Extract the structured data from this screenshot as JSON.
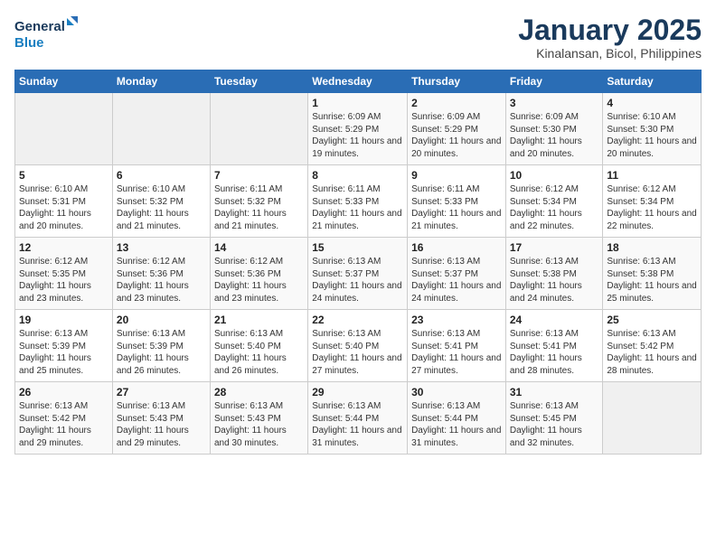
{
  "header": {
    "logo_line1": "General",
    "logo_line2": "Blue",
    "month": "January 2025",
    "location": "Kinalansan, Bicol, Philippines"
  },
  "weekdays": [
    "Sunday",
    "Monday",
    "Tuesday",
    "Wednesday",
    "Thursday",
    "Friday",
    "Saturday"
  ],
  "weeks": [
    [
      {
        "day": "",
        "info": ""
      },
      {
        "day": "",
        "info": ""
      },
      {
        "day": "",
        "info": ""
      },
      {
        "day": "1",
        "info": "Sunrise: 6:09 AM\nSunset: 5:29 PM\nDaylight: 11 hours and 19 minutes."
      },
      {
        "day": "2",
        "info": "Sunrise: 6:09 AM\nSunset: 5:29 PM\nDaylight: 11 hours and 20 minutes."
      },
      {
        "day": "3",
        "info": "Sunrise: 6:09 AM\nSunset: 5:30 PM\nDaylight: 11 hours and 20 minutes."
      },
      {
        "day": "4",
        "info": "Sunrise: 6:10 AM\nSunset: 5:30 PM\nDaylight: 11 hours and 20 minutes."
      }
    ],
    [
      {
        "day": "5",
        "info": "Sunrise: 6:10 AM\nSunset: 5:31 PM\nDaylight: 11 hours and 20 minutes."
      },
      {
        "day": "6",
        "info": "Sunrise: 6:10 AM\nSunset: 5:32 PM\nDaylight: 11 hours and 21 minutes."
      },
      {
        "day": "7",
        "info": "Sunrise: 6:11 AM\nSunset: 5:32 PM\nDaylight: 11 hours and 21 minutes."
      },
      {
        "day": "8",
        "info": "Sunrise: 6:11 AM\nSunset: 5:33 PM\nDaylight: 11 hours and 21 minutes."
      },
      {
        "day": "9",
        "info": "Sunrise: 6:11 AM\nSunset: 5:33 PM\nDaylight: 11 hours and 21 minutes."
      },
      {
        "day": "10",
        "info": "Sunrise: 6:12 AM\nSunset: 5:34 PM\nDaylight: 11 hours and 22 minutes."
      },
      {
        "day": "11",
        "info": "Sunrise: 6:12 AM\nSunset: 5:34 PM\nDaylight: 11 hours and 22 minutes."
      }
    ],
    [
      {
        "day": "12",
        "info": "Sunrise: 6:12 AM\nSunset: 5:35 PM\nDaylight: 11 hours and 23 minutes."
      },
      {
        "day": "13",
        "info": "Sunrise: 6:12 AM\nSunset: 5:36 PM\nDaylight: 11 hours and 23 minutes."
      },
      {
        "day": "14",
        "info": "Sunrise: 6:12 AM\nSunset: 5:36 PM\nDaylight: 11 hours and 23 minutes."
      },
      {
        "day": "15",
        "info": "Sunrise: 6:13 AM\nSunset: 5:37 PM\nDaylight: 11 hours and 24 minutes."
      },
      {
        "day": "16",
        "info": "Sunrise: 6:13 AM\nSunset: 5:37 PM\nDaylight: 11 hours and 24 minutes."
      },
      {
        "day": "17",
        "info": "Sunrise: 6:13 AM\nSunset: 5:38 PM\nDaylight: 11 hours and 24 minutes."
      },
      {
        "day": "18",
        "info": "Sunrise: 6:13 AM\nSunset: 5:38 PM\nDaylight: 11 hours and 25 minutes."
      }
    ],
    [
      {
        "day": "19",
        "info": "Sunrise: 6:13 AM\nSunset: 5:39 PM\nDaylight: 11 hours and 25 minutes."
      },
      {
        "day": "20",
        "info": "Sunrise: 6:13 AM\nSunset: 5:39 PM\nDaylight: 11 hours and 26 minutes."
      },
      {
        "day": "21",
        "info": "Sunrise: 6:13 AM\nSunset: 5:40 PM\nDaylight: 11 hours and 26 minutes."
      },
      {
        "day": "22",
        "info": "Sunrise: 6:13 AM\nSunset: 5:40 PM\nDaylight: 11 hours and 27 minutes."
      },
      {
        "day": "23",
        "info": "Sunrise: 6:13 AM\nSunset: 5:41 PM\nDaylight: 11 hours and 27 minutes."
      },
      {
        "day": "24",
        "info": "Sunrise: 6:13 AM\nSunset: 5:41 PM\nDaylight: 11 hours and 28 minutes."
      },
      {
        "day": "25",
        "info": "Sunrise: 6:13 AM\nSunset: 5:42 PM\nDaylight: 11 hours and 28 minutes."
      }
    ],
    [
      {
        "day": "26",
        "info": "Sunrise: 6:13 AM\nSunset: 5:42 PM\nDaylight: 11 hours and 29 minutes."
      },
      {
        "day": "27",
        "info": "Sunrise: 6:13 AM\nSunset: 5:43 PM\nDaylight: 11 hours and 29 minutes."
      },
      {
        "day": "28",
        "info": "Sunrise: 6:13 AM\nSunset: 5:43 PM\nDaylight: 11 hours and 30 minutes."
      },
      {
        "day": "29",
        "info": "Sunrise: 6:13 AM\nSunset: 5:44 PM\nDaylight: 11 hours and 31 minutes."
      },
      {
        "day": "30",
        "info": "Sunrise: 6:13 AM\nSunset: 5:44 PM\nDaylight: 11 hours and 31 minutes."
      },
      {
        "day": "31",
        "info": "Sunrise: 6:13 AM\nSunset: 5:45 PM\nDaylight: 11 hours and 32 minutes."
      },
      {
        "day": "",
        "info": ""
      }
    ]
  ]
}
